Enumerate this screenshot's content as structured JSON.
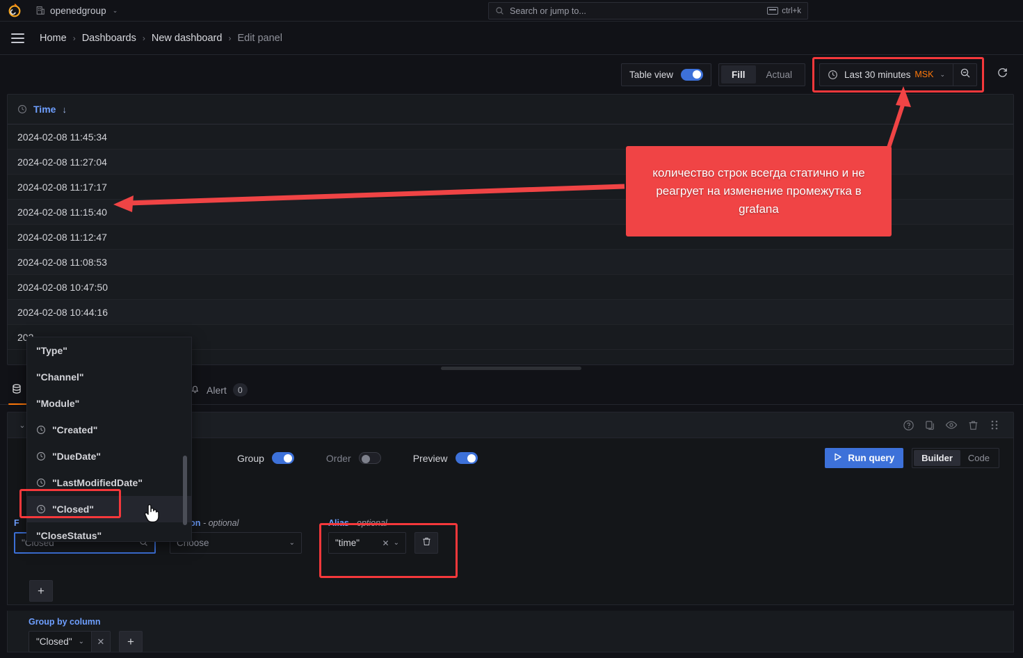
{
  "topnav": {
    "org_name": "openedgroup",
    "org_icon": "building-icon",
    "chevron": "⌄",
    "logo_icon": "grafana-logo-icon"
  },
  "search": {
    "placeholder": "Search or jump to...",
    "shortcut": "ctrl+k",
    "icon": "search-icon",
    "keyboard_icon": "keyboard-icon"
  },
  "breadcrumb": {
    "items": [
      "Home",
      "Dashboards",
      "New dashboard",
      "Edit panel"
    ],
    "separator": "›",
    "menu_icon": "hamburger-menu-icon"
  },
  "toolbar": {
    "table_view_label": "Table view",
    "table_view_on": true,
    "fill_label": "Fill",
    "actual_label": "Actual",
    "fill_active": true,
    "time_range": "Last 30 minutes",
    "timezone": "MSK",
    "clock_icon": "clock-icon",
    "chevron": "⌄",
    "zoom_out_icon": "zoom-out-icon",
    "refresh_icon": "refresh-icon",
    "highlight_color": "#f5383b"
  },
  "table": {
    "column_header": "Time",
    "sort_arrow": "↓",
    "clock_icon": "clock-icon",
    "rows": [
      "2024-02-08 11:45:34",
      "2024-02-08 11:27:04",
      "2024-02-08 11:17:17",
      "2024-02-08 11:15:40",
      "2024-02-08 11:12:47",
      "2024-02-08 11:08:53",
      "2024-02-08 10:47:50",
      "2024-02-08 10:44:16",
      "202"
    ]
  },
  "annotation": {
    "text": "количество строк всегда статично и не реагрует на изменение промежутка в grafana",
    "color": "#f04445"
  },
  "tabs": {
    "items": [
      {
        "label": "",
        "icon": "database-icon",
        "active": true
      },
      {
        "label": "Alert",
        "icon": "bell-icon",
        "badge": "0",
        "active": false
      }
    ]
  },
  "query_row": {
    "collapse_chevron": "⌄",
    "actions": [
      "help-icon",
      "duplicate-icon",
      "eye-icon",
      "trash-icon",
      "drag-handle-icon"
    ]
  },
  "query_options": {
    "group_label": "Group",
    "group_on": true,
    "order_label": "Order",
    "order_on": false,
    "preview_label": "Preview",
    "preview_on": true,
    "run_query_label": "Run query",
    "run_icon": "play-icon",
    "builder_label": "Builder",
    "code_label": "Code",
    "builder_active": true
  },
  "fields": {
    "field_label": "F",
    "column_value": "\"Closed\"",
    "column_search_icon": "search-icon",
    "aggregation_label": "egation",
    "aggregation_optional": "- optional",
    "aggregation_value": "Choose",
    "alias_label": "Alias",
    "alias_optional": "- optional",
    "alias_value": "\"time\"",
    "alias_clear": "✕",
    "alias_chevron": "⌄",
    "delete_icon": "trash-icon",
    "add_label": "+"
  },
  "group_by": {
    "label": "Group by column",
    "value": "\"Closed\"",
    "chevron": "⌄",
    "clear": "✕",
    "add_label": "+"
  },
  "dropdown": {
    "items": [
      {
        "label": "\"Type\"",
        "has_clock": false,
        "selected": false
      },
      {
        "label": "\"Channel\"",
        "has_clock": false,
        "selected": false
      },
      {
        "label": "\"Module\"",
        "has_clock": false,
        "selected": false
      },
      {
        "label": "\"Created\"",
        "has_clock": true,
        "selected": false
      },
      {
        "label": "\"DueDate\"",
        "has_clock": true,
        "selected": false
      },
      {
        "label": "\"LastModifiedDate\"",
        "has_clock": true,
        "selected": false
      },
      {
        "label": "\"Closed\"",
        "has_clock": true,
        "selected": true
      },
      {
        "label": "\"CloseStatus\"",
        "has_clock": false,
        "selected": false
      }
    ],
    "cursor_icon": "pointer-cursor-icon"
  }
}
